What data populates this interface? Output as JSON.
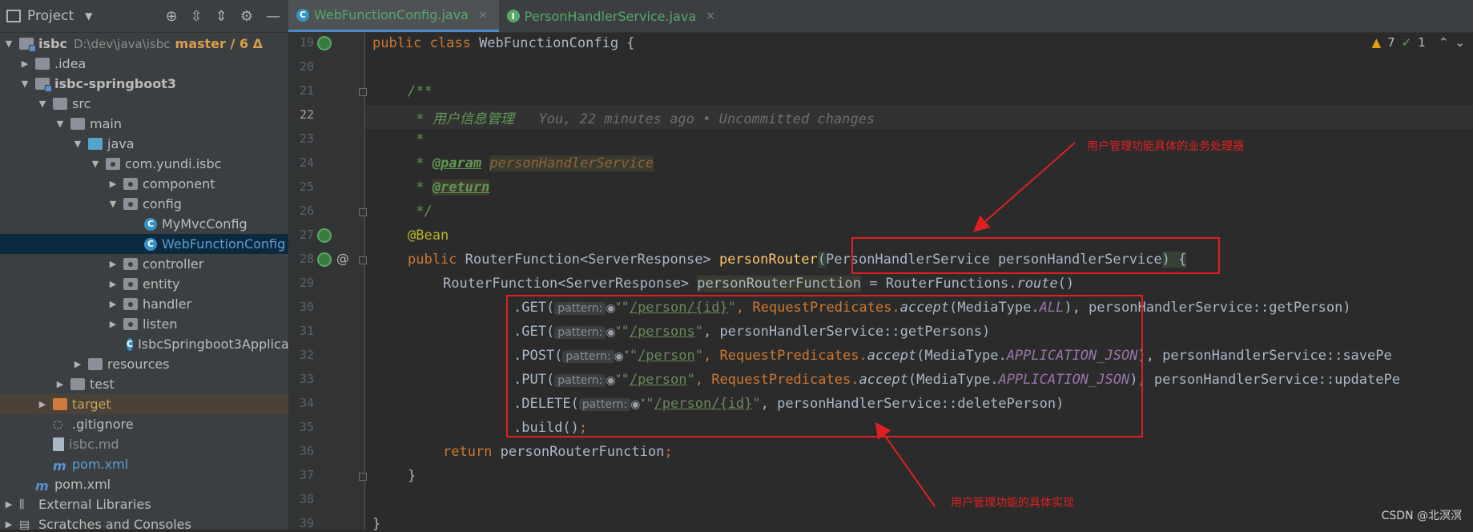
{
  "project_panel": {
    "title": "Project",
    "tree": [
      {
        "label": "isbc",
        "path": "D:\\dev\\java\\isbc",
        "branch": "master / 6 Δ"
      },
      {
        "label": ".idea"
      },
      {
        "label": "isbc-springboot3"
      },
      {
        "label": "src"
      },
      {
        "label": "main"
      },
      {
        "label": "java"
      },
      {
        "label": "com.yundi.isbc"
      },
      {
        "label": "component"
      },
      {
        "label": "config"
      },
      {
        "label": "MyMvcConfig",
        "icon": "C"
      },
      {
        "label": "WebFunctionConfig",
        "icon": "C"
      },
      {
        "label": "controller"
      },
      {
        "label": "entity"
      },
      {
        "label": "handler"
      },
      {
        "label": "listen"
      },
      {
        "label": "IsbcSpringboot3Applica"
      },
      {
        "label": "resources"
      },
      {
        "label": "test"
      },
      {
        "label": "target"
      },
      {
        "label": ".gitignore"
      },
      {
        "label": "isbc.md"
      },
      {
        "label": "pom.xml"
      },
      {
        "label": "pom.xml"
      },
      {
        "label": "External Libraries"
      },
      {
        "label": "Scratches and Consoles"
      }
    ]
  },
  "tabs": [
    {
      "label": "WebFunctionConfig.java",
      "icon": "C",
      "close": "×"
    },
    {
      "label": "PersonHandlerService.java",
      "icon": "I",
      "close": "×"
    }
  ],
  "inspections": {
    "warnings": "7",
    "ok": "1"
  },
  "line_numbers": [
    "19",
    "20",
    "21",
    "22",
    "23",
    "24",
    "25",
    "26",
    "27",
    "28",
    "29",
    "30",
    "31",
    "32",
    "33",
    "34",
    "35",
    "36",
    "37",
    "38",
    "39"
  ],
  "code": {
    "l19": {
      "kw": "public class",
      "name": " WebFunctionConfig {"
    },
    "l21": "/**",
    "l22": {
      "text": " * 用户信息管理",
      "blame": "You, 22 minutes ago • Uncommitted changes"
    },
    "l23": " *",
    "l24": {
      "prefix": " * ",
      "tag": "@param",
      "value": "personHandlerService"
    },
    "l25": {
      "prefix": " * ",
      "tag": "@return"
    },
    "l26": " */",
    "l27": "@Bean",
    "l28": {
      "kw": "public",
      "type": " RouterFunction<ServerResponse> ",
      "fn": "personRouter",
      "open": "(",
      "params": "PersonHandlerService personHandlerService",
      "close": ") {"
    },
    "l29": {
      "type": "RouterFunction<ServerResponse> ",
      "var": "personRouterFunction",
      "assign": " = RouterFunctions.",
      "method": "route",
      "end": "()"
    },
    "l30": {
      "call": ".GET(",
      "hint": "pattern:",
      "globe": "◉˅",
      "q1": "\"",
      "path": "/person/{id}",
      "q2": "\"",
      "rest": ", RequestPredicates.",
      "accept": "accept",
      "media": "(MediaType.",
      "const": "ALL",
      "tail": "), personHandlerService::getPerson)"
    },
    "l31": {
      "call": ".GET(",
      "hint": "pattern:",
      "globe": "◉˅",
      "q1": "\"",
      "path": "/persons",
      "q2": "\"",
      "tail": ", personHandlerService::getPersons)"
    },
    "l32": {
      "call": ".POST(",
      "hint": "pattern:",
      "globe": "◉˅",
      "q1": "\"",
      "path": "/person",
      "q2": "\"",
      "rest": ", RequestPredicates.",
      "accept": "accept",
      "media": "(MediaType.",
      "const": "APPLICATION_JSON",
      "tail": "), personHandlerService::savePe"
    },
    "l33": {
      "call": ".PUT(",
      "hint": "pattern:",
      "globe": "◉˅",
      "q1": "\"",
      "path": "/person",
      "q2": "\"",
      "rest": ", RequestPredicates.",
      "accept": "accept",
      "media": "(MediaType.",
      "const": "APPLICATION_JSON",
      "tail": "), personHandlerService::updatePe"
    },
    "l34": {
      "call": ".DELETE(",
      "hint": "pattern:",
      "globe": "◉˅",
      "q1": "\"",
      "path": "/person/{id}",
      "q2": "\"",
      "tail": ", personHandlerService::deletePerson)"
    },
    "l35": {
      "call": ".build()",
      "semi": ";"
    },
    "l36": {
      "kw": "return",
      "rest": " personRouterFunction",
      "semi": ";"
    },
    "l37": "}",
    "l39": "}"
  },
  "annotations": {
    "top": "用户管理功能具体的业务处理器",
    "bottom": "用户管理功能的具体实现"
  },
  "colors": {
    "annotation": "#e02020",
    "accent": "#4a88c7"
  },
  "watermark": "CSDN @北溟溟"
}
